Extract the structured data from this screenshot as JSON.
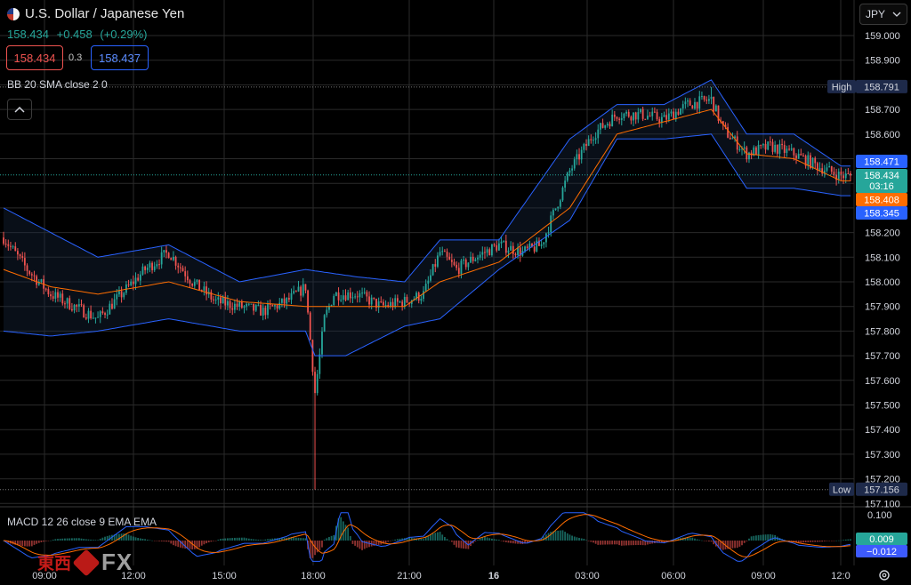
{
  "symbol": {
    "title": "U.S. Dollar / Japanese Yen",
    "price": "158.434",
    "change": "+0.458",
    "change_pct": "(+0.29%)",
    "bid": "158.434",
    "spread": "0.3",
    "ask": "158.437"
  },
  "currency_selector": {
    "label": "JPY",
    "icon": "chevron-down-icon"
  },
  "indicator": {
    "label": "BB 20 SMA close 2 0",
    "collapse_icon": "chevron-up-icon"
  },
  "macd": {
    "label": "MACD 12 26 close 9 EMA EMA"
  },
  "price_axis": {
    "ticks": [
      "159.000",
      "158.900",
      "158.800",
      "158.700",
      "158.600",
      "158.500",
      "158.400",
      "158.300",
      "158.200",
      "158.100",
      "158.000",
      "157.900",
      "157.800",
      "157.700",
      "157.600",
      "157.500",
      "157.400",
      "157.300",
      "157.200",
      "157.100"
    ]
  },
  "price_badges": {
    "high_label": "High",
    "high_value": "158.791",
    "low_label": "Low",
    "low_value": "157.156",
    "bb_upper": "158.471",
    "last_price": "158.434",
    "countdown": "03:16",
    "bb_basis": "158.408",
    "bb_lower": "158.345"
  },
  "macd_axis": {
    "top_tick": "0.100",
    "macd_value": "0.009",
    "signal_value": "−0.012"
  },
  "time_axis": {
    "labels": [
      "09:00",
      "12:00",
      "15:00",
      "18:00",
      "21:00",
      "16",
      "03:00",
      "06:00",
      "09:00",
      "12:0"
    ]
  },
  "settings_icon": "gear-icon",
  "watermark": {
    "cn": "東西",
    "fx": "FX"
  },
  "colors": {
    "up": "#26a69a",
    "down": "#ef5350",
    "bb_band": "#2962ff",
    "bb_basis": "#ff6d00",
    "grid": "#2a2a2a",
    "macd": "#2962ff",
    "signal": "#ff6d00"
  },
  "chart_data": {
    "type": "candlestick",
    "title": "U.S. Dollar / Japanese Yen",
    "xlabel": "",
    "ylabel": "",
    "ylim": [
      157.1,
      159.05
    ],
    "x_ticks": [
      "09:00",
      "12:00",
      "15:00",
      "18:00",
      "21:00",
      "16",
      "03:00",
      "06:00",
      "09:00",
      "12:0"
    ],
    "close_path_anchors": [
      [
        0,
        158.18
      ],
      [
        10,
        158.05
      ],
      [
        20,
        157.95
      ],
      [
        30,
        157.9
      ],
      [
        40,
        157.85
      ],
      [
        50,
        157.95
      ],
      [
        60,
        158.05
      ],
      [
        70,
        158.12
      ],
      [
        80,
        158.0
      ],
      [
        90,
        157.92
      ],
      [
        100,
        157.9
      ],
      [
        110,
        157.88
      ],
      [
        120,
        157.92
      ],
      [
        128,
        157.98
      ],
      [
        132,
        157.55
      ],
      [
        136,
        157.85
      ],
      [
        140,
        157.95
      ],
      [
        150,
        157.95
      ],
      [
        160,
        157.9
      ],
      [
        170,
        157.92
      ],
      [
        178,
        157.95
      ],
      [
        185,
        158.12
      ],
      [
        192,
        158.05
      ],
      [
        200,
        158.1
      ],
      [
        210,
        158.15
      ],
      [
        220,
        158.12
      ],
      [
        228,
        158.15
      ],
      [
        240,
        158.45
      ],
      [
        250,
        158.6
      ],
      [
        260,
        158.68
      ],
      [
        270,
        158.68
      ],
      [
        280,
        158.66
      ],
      [
        290,
        158.72
      ],
      [
        300,
        158.74
      ],
      [
        305,
        158.62
      ],
      [
        315,
        158.52
      ],
      [
        325,
        158.55
      ],
      [
        335,
        158.52
      ],
      [
        345,
        158.47
      ],
      [
        355,
        158.43
      ]
    ],
    "bollinger_upper_anchors": [
      [
        0,
        158.3
      ],
      [
        20,
        158.2
      ],
      [
        40,
        158.1
      ],
      [
        70,
        158.15
      ],
      [
        100,
        158.0
      ],
      [
        128,
        158.05
      ],
      [
        150,
        158.02
      ],
      [
        170,
        158.0
      ],
      [
        185,
        158.17
      ],
      [
        210,
        158.17
      ],
      [
        240,
        158.58
      ],
      [
        260,
        158.72
      ],
      [
        280,
        158.72
      ],
      [
        300,
        158.82
      ],
      [
        315,
        158.6
      ],
      [
        335,
        158.6
      ],
      [
        355,
        158.47
      ]
    ],
    "bollinger_lower_anchors": [
      [
        0,
        157.8
      ],
      [
        20,
        157.78
      ],
      [
        40,
        157.8
      ],
      [
        70,
        157.85
      ],
      [
        100,
        157.8
      ],
      [
        128,
        157.8
      ],
      [
        132,
        157.7
      ],
      [
        145,
        157.7
      ],
      [
        170,
        157.82
      ],
      [
        185,
        157.85
      ],
      [
        210,
        158.05
      ],
      [
        240,
        158.25
      ],
      [
        260,
        158.58
      ],
      [
        280,
        158.58
      ],
      [
        300,
        158.6
      ],
      [
        315,
        158.38
      ],
      [
        335,
        158.38
      ],
      [
        355,
        158.35
      ]
    ],
    "bollinger_basis_anchors": [
      [
        0,
        158.05
      ],
      [
        20,
        157.98
      ],
      [
        40,
        157.95
      ],
      [
        70,
        158.0
      ],
      [
        100,
        157.92
      ],
      [
        128,
        157.9
      ],
      [
        150,
        157.9
      ],
      [
        170,
        157.9
      ],
      [
        185,
        158.0
      ],
      [
        210,
        158.08
      ],
      [
        240,
        158.3
      ],
      [
        260,
        158.6
      ],
      [
        280,
        158.65
      ],
      [
        300,
        158.7
      ],
      [
        315,
        158.52
      ],
      [
        335,
        158.5
      ],
      [
        355,
        158.41
      ]
    ],
    "high": 158.791,
    "low": 157.156,
    "macd_range": [
      -0.12,
      0.12
    ]
  }
}
